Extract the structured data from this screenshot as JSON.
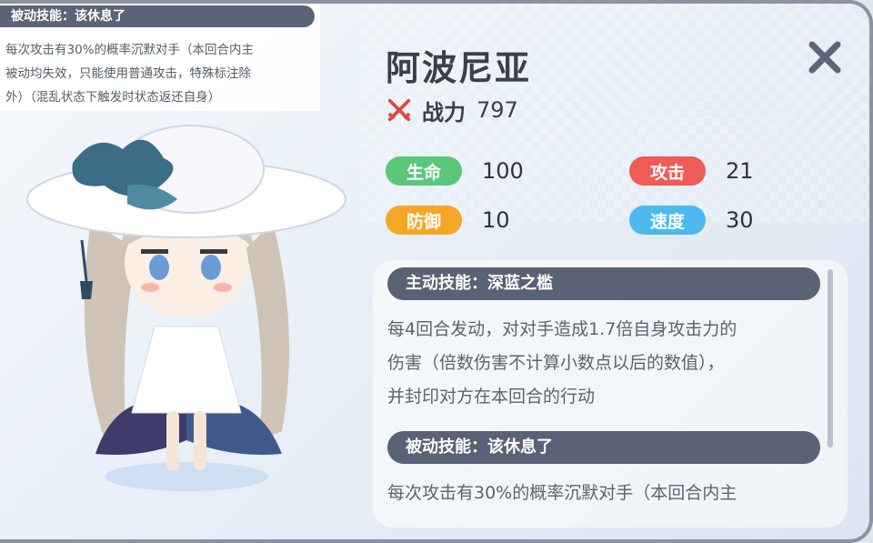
{
  "tooltip": {
    "title": "被动技能：该休息了",
    "lines": [
      "每次攻击有30%的概率沉默对手（本回合内主",
      "被动均失效，只能使用普通攻击，特殊标注除",
      "外）（混乱状态下触发时状态返还自身）"
    ]
  },
  "character": {
    "name": "阿波尼亚",
    "power_label": "战力",
    "power_value": "797",
    "power_icon": "crossed-swords-icon"
  },
  "stats": [
    {
      "label": "生命",
      "value": "100",
      "color": "#5ac77a"
    },
    {
      "label": "攻击",
      "value": "21",
      "color": "#ef5b55"
    },
    {
      "label": "防御",
      "value": "10",
      "color": "#f5a623"
    },
    {
      "label": "速度",
      "value": "30",
      "color": "#4cb9ef"
    }
  ],
  "skills": {
    "active": {
      "title": "主动技能：深蓝之槛",
      "lines": [
        "每4回合发动，对对手造成1.7倍自身攻击力的",
        "伤害（倍数伤害不计算小数点以后的数值），",
        "并封印对方在本回合的行动"
      ]
    },
    "passive": {
      "title": "被动技能：该休息了",
      "lines": [
        "每次攻击有30%的概率沉默对手（本回合内主"
      ]
    }
  },
  "colors": {
    "header_bar": "#5a6275",
    "text_dark": "#3b3f47",
    "close": "#5c6679"
  }
}
